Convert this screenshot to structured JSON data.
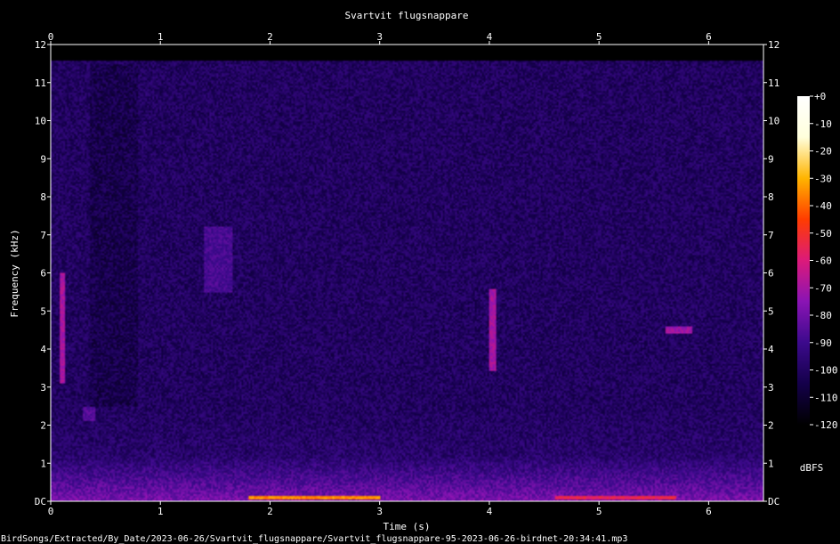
{
  "chart_data": {
    "type": "heatmap",
    "title": "Svartvit flugsnappare",
    "xlabel": "Time (s)",
    "ylabel": "Frequency (kHz)",
    "xlim": [
      0,
      6.5
    ],
    "ylim": [
      0,
      12
    ],
    "x_ticks": [
      "0",
      "1",
      "2",
      "3",
      "4",
      "5",
      "6"
    ],
    "y_ticks": [
      "DC",
      "1",
      "2",
      "3",
      "4",
      "5",
      "6",
      "7",
      "8",
      "9",
      "10",
      "11",
      "12"
    ],
    "colorbar": {
      "label": "dBFS",
      "ticks": [
        "+0",
        "-10",
        "-20",
        "-30",
        "-40",
        "-50",
        "-60",
        "-70",
        "-80",
        "-90",
        "-100",
        "-110",
        "-120"
      ],
      "range": [
        -120,
        0
      ]
    },
    "events": [
      {
        "t_start": 0.08,
        "t_end": 0.13,
        "f_low": 3.1,
        "f_high": 6.0,
        "level_db": -70
      },
      {
        "t_start": 0.3,
        "t_end": 0.4,
        "f_low": 2.1,
        "f_high": 2.5,
        "level_db": -85
      },
      {
        "t_start": 1.4,
        "t_end": 1.65,
        "f_low": 5.5,
        "f_high": 7.2,
        "level_db": -88
      },
      {
        "t_start": 1.8,
        "t_end": 3.0,
        "f_low": 0.05,
        "f_high": 0.15,
        "level_db": -35
      },
      {
        "t_start": 3.99,
        "t_end": 4.06,
        "f_low": 3.4,
        "f_high": 5.6,
        "level_db": -70
      },
      {
        "t_start": 4.6,
        "t_end": 5.7,
        "f_low": 0.05,
        "f_high": 0.15,
        "level_db": -55
      },
      {
        "t_start": 5.6,
        "t_end": 5.85,
        "f_low": 4.4,
        "f_high": 4.6,
        "level_db": -72
      }
    ],
    "grid": false
  },
  "footer": {
    "filename": "BirdSongs/Extracted/By_Date/2023-06-26/Svartvit_flugsnappare/Svartvit_flugsnappare-95-2023-06-26-birdnet-20:34:41.mp3"
  },
  "colors": {
    "background": "#000000",
    "colormap": [
      "#000000",
      "#14004a",
      "#3c0a8c",
      "#8a14b4",
      "#dc1a7a",
      "#ff3c00",
      "#ffb400",
      "#ffffdc",
      "#ffffff"
    ]
  }
}
